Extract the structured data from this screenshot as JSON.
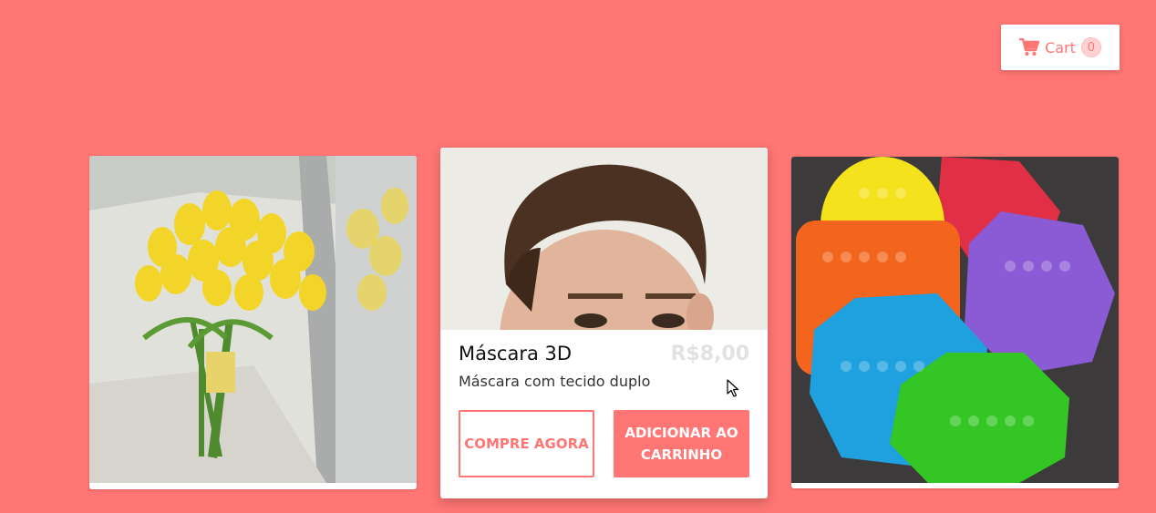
{
  "header": {
    "cart_label": "Cart",
    "cart_count": "0"
  },
  "products": [
    {
      "image": "yellow-tulip-bouquet-photo"
    },
    {
      "image": "young-man-face-photo",
      "title": "Máscara 3D",
      "price": "R$8,00",
      "description": "Máscara com tecido duplo",
      "buy_now_label": "COMPRE AGORA",
      "add_to_cart_label": "ADICIONAR AO CARRINHO"
    },
    {
      "image": "colorful-pop-it-toys-photo"
    }
  ],
  "colors": {
    "background": "#ff7674",
    "accent": "#ff7674",
    "price_text": "#e2e2e2"
  }
}
